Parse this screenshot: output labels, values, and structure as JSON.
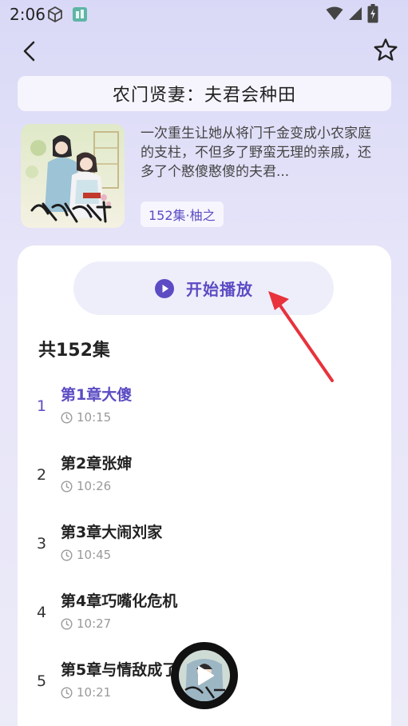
{
  "status_bar": {
    "time": "2:06"
  },
  "header": {
    "title": "农门贤妻：夫君会种田"
  },
  "book": {
    "synopsis": "一次重生让她从将门千金变成小农家庭的支柱，不但多了野蛮无理的亲戚，还多了个憨傻憨傻的夫君...",
    "tag": "152集·柚之"
  },
  "player": {
    "play_label": "开始播放"
  },
  "episodes_total": "共152集",
  "episodes": [
    {
      "num": "1",
      "title": "第1章大傻",
      "duration": "10:15",
      "active": true
    },
    {
      "num": "2",
      "title": "第2章张婶",
      "duration": "10:26",
      "active": false
    },
    {
      "num": "3",
      "title": "第3章大闹刘家",
      "duration": "10:45",
      "active": false
    },
    {
      "num": "4",
      "title": "第4章巧嘴化危机",
      "duration": "10:27",
      "active": false
    },
    {
      "num": "5",
      "title": "第5章与情敌成了",
      "duration": "10:21",
      "active": false
    }
  ],
  "colors": {
    "accent": "#5b4cc4",
    "arrow": "#e8323c"
  }
}
